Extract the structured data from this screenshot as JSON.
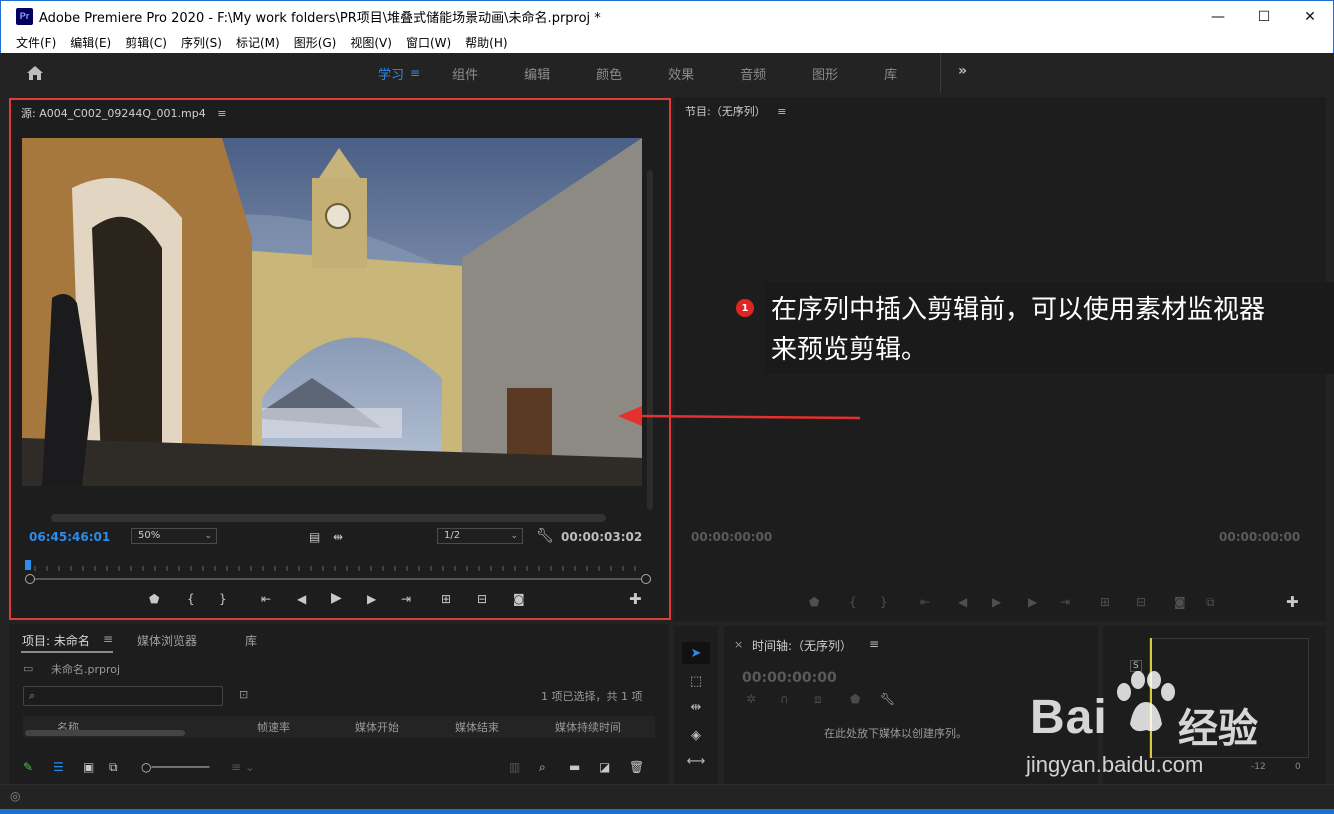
{
  "window": {
    "app_icon_label": "Pr",
    "title": "Adobe Premiere Pro 2020 - F:\\My work folders\\PR项目\\堆叠式储能场景动画\\未命名.prproj *",
    "controls": [
      "—",
      "☐",
      "✕"
    ]
  },
  "menu": [
    "文件(F)",
    "编辑(E)",
    "剪辑(C)",
    "序列(S)",
    "标记(M)",
    "图形(G)",
    "视图(V)",
    "窗口(W)",
    "帮助(H)"
  ],
  "workspaces": {
    "tabs": [
      "学习",
      "组件",
      "编辑",
      "颜色",
      "效果",
      "音频",
      "图形",
      "库"
    ],
    "active": "学习",
    "more": "»"
  },
  "source_monitor": {
    "title": "源: A004_C002_09244Q_001.mp4",
    "menu_icon": "≡",
    "current_timecode": "06:45:46:01",
    "zoom": "50%",
    "resolution": "1/2",
    "duration": "00:00:03:02"
  },
  "program_monitor": {
    "title": "节目:（无序列）",
    "menu_icon": "≡",
    "timecode_left": "00:00:00:00",
    "timecode_right": "00:00:00:00"
  },
  "callout": {
    "badge": "1",
    "text_line1": "在序列中插入剪辑前，可以使用素材监视器",
    "text_line2": "来预览剪辑。"
  },
  "project_panel": {
    "tabs": [
      "项目: 未命名",
      "媒体浏览器",
      "库"
    ],
    "tab_menu": "≡",
    "file_name": "未命名.prproj",
    "selection_status": "1 项已选择，共 1 项",
    "columns": [
      "名称",
      "帧速率",
      "媒体开始",
      "媒体结束",
      "媒体持续时间"
    ]
  },
  "timeline_panel": {
    "close": "×",
    "title": "时间轴:（无序列）",
    "menu_icon": "≡",
    "timecode": "00:00:00:00",
    "drop_hint": "在此处放下媒体以创建序列。"
  },
  "audio_meter": {
    "solo_label": "S",
    "scale": [
      "-12",
      "0"
    ]
  },
  "watermark": {
    "brand": "Bai",
    "brand_cn": "经验",
    "url": "jingyan.baidu.com"
  }
}
